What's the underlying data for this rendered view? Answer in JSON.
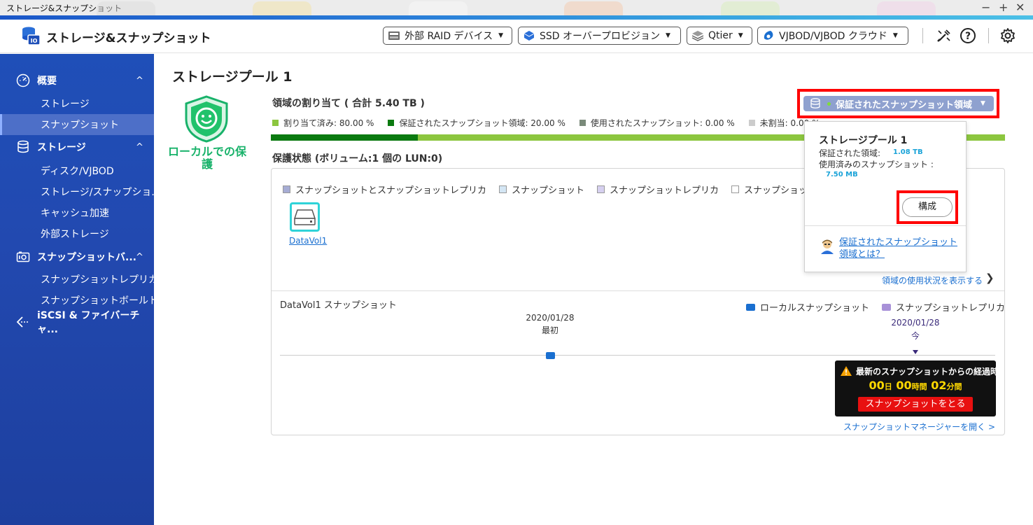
{
  "window": {
    "title": "ストレージ&スナップショット"
  },
  "app": {
    "title": "ストレージ&スナップショット"
  },
  "header": {
    "raid_label": "外部 RAID デバイス",
    "ssd_label": "SSD オーバープロビジョン",
    "qtier_label": "Qtier",
    "vjbod_label": "VJBOD/VJBOD クラウド"
  },
  "sidebar": {
    "groups": [
      {
        "label": "概要",
        "icon": "gauge-icon",
        "chevron": "^",
        "items": [
          {
            "label": "ストレージ"
          },
          {
            "label": "スナップショット",
            "active": true
          }
        ]
      },
      {
        "label": "ストレージ",
        "icon": "database-icon",
        "chevron": "^",
        "items": [
          {
            "label": "ディスク/VJBOD"
          },
          {
            "label": "ストレージ/スナップショ..."
          },
          {
            "label": "キャッシュ加速"
          },
          {
            "label": "外部ストレージ"
          }
        ]
      },
      {
        "label": "スナップショットバ...",
        "icon": "camera-icon",
        "chevron": "^",
        "items": [
          {
            "label": "スナップショットレプリカ"
          },
          {
            "label": "スナップショットボールト"
          }
        ]
      },
      {
        "label": "iSCSI & ファイバーチャ...",
        "icon": "iscsi-icon",
        "chevron": "",
        "items": []
      }
    ]
  },
  "main": {
    "page_title": "ストレージプール 1",
    "protection_label": "ローカルでの保護",
    "allocation": {
      "title": "領域の割り当て ( 合計 5.40 TB )",
      "legend": [
        {
          "label": "割り当て済み: 80.00 %",
          "color": "#8cc63f"
        },
        {
          "label": "保証されたスナップショット領域: 20.00 %",
          "color": "#0b7a10"
        },
        {
          "label": "使用されたスナップショット: 0.00 %",
          "color": "#7a8a7a"
        },
        {
          "label": "未割当: 0.00 %",
          "color": "#cccccc"
        }
      ],
      "bar_segments": [
        {
          "name": "guaranteed-snapshot-segment",
          "percent": 20,
          "color": "#0b7a10"
        },
        {
          "name": "allocated-segment",
          "percent": 80,
          "color": "#8cc63f"
        }
      ]
    },
    "protection_status": {
      "title": "保護状態 (ボリューム:1 個の LUN:0)",
      "legend": [
        {
          "label": "スナップショットとスナップショットレプリカ",
          "color": "#a6acd4"
        },
        {
          "label": "スナップショット",
          "color": "#d4e6f4"
        },
        {
          "label": "スナップショットレプリカ",
          "color": "#d6d0f0"
        },
        {
          "label": "スナップショットなし",
          "color": "#ffffff"
        }
      ],
      "volume_name": "DataVol1",
      "usage_link": "領域の使用状況を表示する"
    },
    "timeline": {
      "title": "DataVol1 スナップショット",
      "legend_local": "ローカルスナップショット",
      "legend_replica": "スナップショットレプリカ",
      "first_date": "2020/01/28",
      "first_label": "最初",
      "now_date": "2020/01/28",
      "now_label": "今",
      "elapsed_message": "最新のスナップショットからの経過時",
      "elapsed_days": "00",
      "elapsed_days_unit": "日",
      "elapsed_hours": "00",
      "elapsed_hours_unit": "時間",
      "elapsed_minutes": "02",
      "elapsed_minutes_unit": "分間",
      "take_snapshot_label": "スナップショットをとる",
      "manager_link": "スナップショットマネージャーを開く >"
    }
  },
  "guaranteed_button": {
    "label": "保証されたスナップショット領域"
  },
  "popover": {
    "title": "ストレージプール 1",
    "guaranteed_label": "保証された領域:",
    "guaranteed_value": "1.08 TB",
    "used_label": "使用済みのスナップショット :",
    "used_value": "7.50 MB",
    "configure_label": "構成",
    "help_link": "保証されたスナップショット領域とは？"
  },
  "colors": {
    "accent": "#1a6fd0",
    "sidebar": "#2249b0",
    "highlight": "#ff0000",
    "protected": "#18b26a",
    "timer": "#ffd800"
  }
}
